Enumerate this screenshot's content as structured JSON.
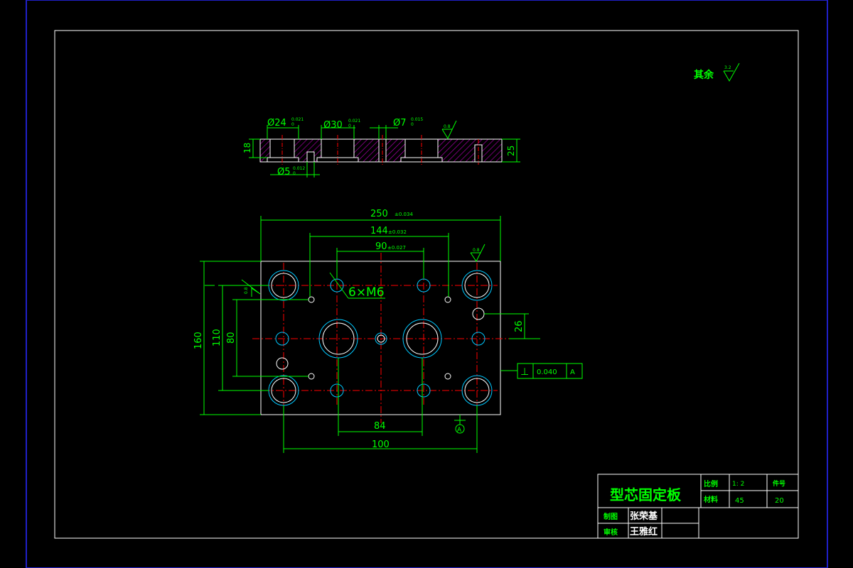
{
  "colors": {
    "background": "#000000",
    "frame": "#ffffff",
    "outer_frame": "#2020c8",
    "dimension": "#00ff00",
    "centerline": "#ff0000",
    "hole": "#ffffff",
    "hole_chamfer": "#00c8ff",
    "hatch": "#c000c0"
  },
  "surface_roughness": {
    "rest_label": "其余",
    "rest_value": "3.2",
    "top_face_value": "0.8",
    "plan_top_value": "0.8",
    "plan_left_value": "0.8"
  },
  "section_view": {
    "dims": {
      "d24": "Ø24",
      "d24_tol_upper": "0.021",
      "d24_tol_lower": "0",
      "d30": "Ø30",
      "d30_tol_upper": "0.021",
      "d30_tol_lower": "0",
      "d7": "Ø7",
      "d7_tol_upper": "0.015",
      "d7_tol_lower": "0",
      "d5": "Ø5",
      "d5_tol_upper": "0.012",
      "d5_tol_lower": "0",
      "height_18": "18",
      "height_25": "25"
    }
  },
  "plan_view": {
    "dims": {
      "width_250": "250",
      "width_250_tol": "±0.034",
      "span_144": "144",
      "span_144_tol": "±0.032",
      "span_90": "90",
      "span_90_tol": "±0.027",
      "thread_callout": "6×M6",
      "height_160": "160",
      "height_110": "110",
      "height_80": "80",
      "offset_26": "26",
      "span_84": "84",
      "span_100": "100"
    },
    "tolerance_frame": {
      "symbol": "⊥",
      "value": "0.040",
      "datum": "A"
    },
    "datum_label": "A"
  },
  "title_block": {
    "part_name": "型芯固定板",
    "scale_label": "比例",
    "scale_value": "1: 2",
    "part_no_label": "件号",
    "part_no_value": "20",
    "material_label": "材料",
    "material_value": "45",
    "drawn_label": "制图",
    "drawn_value": "张荣基",
    "checked_label": "审核",
    "checked_value": "王雅红"
  }
}
